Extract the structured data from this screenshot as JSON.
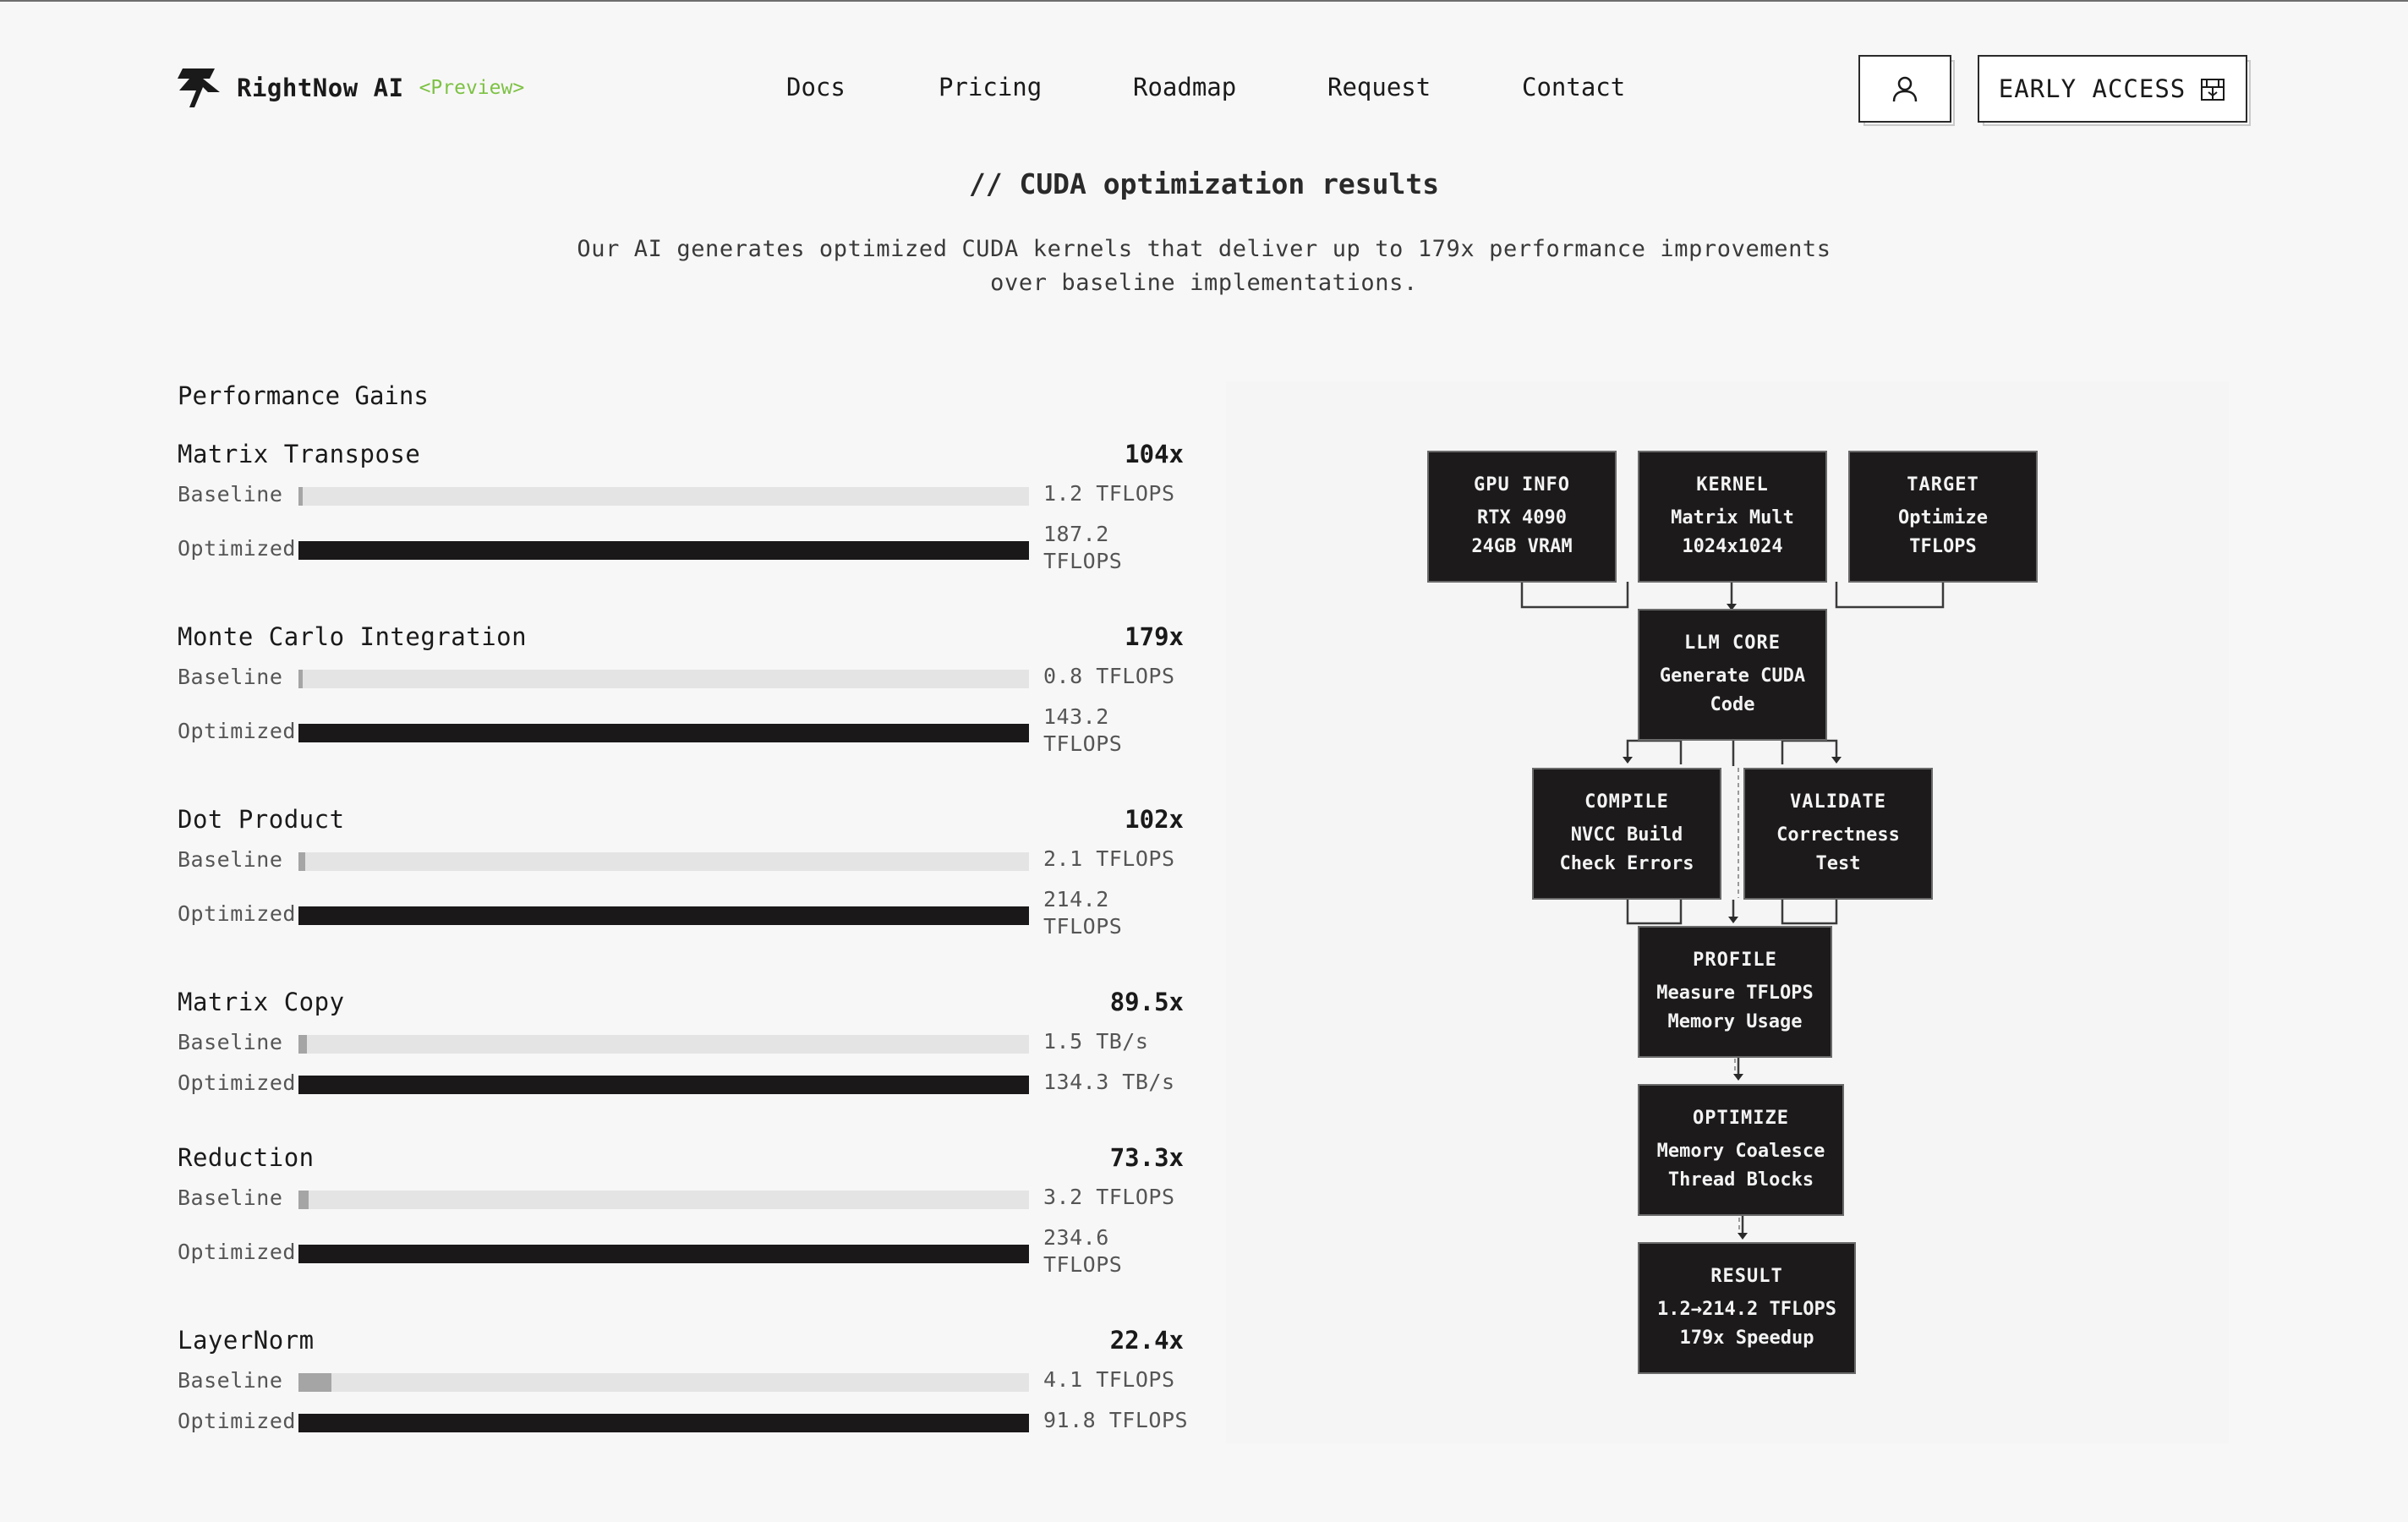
{
  "brand": {
    "name": "RightNow AI",
    "tag": "<Preview>",
    "accent": "#7cc243"
  },
  "nav": {
    "items": [
      "Docs",
      "Pricing",
      "Roadmap",
      "Request",
      "Contact"
    ]
  },
  "actions": {
    "user_icon": "user-icon",
    "early_access_label": "EARLY ACCESS",
    "early_access_icon": "open-box-icon"
  },
  "hero": {
    "title": "// CUDA optimization results",
    "description_line1": "Our AI generates optimized CUDA kernels that deliver up to 179x performance improvements",
    "description_line2": "over baseline implementations."
  },
  "performance": {
    "title": "Performance Gains",
    "baseline_label": "Baseline",
    "optimized_label": "Optimized",
    "metrics": [
      {
        "name": "Matrix Transpose",
        "speedup": "104x",
        "baseline_value": "1.2 TFLOPS",
        "optimized_value_line1": "187.2",
        "optimized_value_line2": "TFLOPS",
        "baseline_fraction": 0.006
      },
      {
        "name": "Monte Carlo Integration",
        "speedup": "179x",
        "baseline_value": "0.8 TFLOPS",
        "optimized_value_line1": "143.2",
        "optimized_value_line2": "TFLOPS",
        "baseline_fraction": 0.006
      },
      {
        "name": "Dot Product",
        "speedup": "102x",
        "baseline_value": "2.1 TFLOPS",
        "optimized_value_line1": "214.2",
        "optimized_value_line2": "TFLOPS",
        "baseline_fraction": 0.0098
      },
      {
        "name": "Matrix Copy",
        "speedup": "89.5x",
        "baseline_value": "1.5 TB/s",
        "optimized_value_line1": "134.3 TB/s",
        "optimized_value_line2": "",
        "baseline_fraction": 0.0112
      },
      {
        "name": "Reduction",
        "speedup": "73.3x",
        "baseline_value": "3.2 TFLOPS",
        "optimized_value_line1": "234.6",
        "optimized_value_line2": "TFLOPS",
        "baseline_fraction": 0.0136
      },
      {
        "name": "LayerNorm",
        "speedup": "22.4x",
        "baseline_value": "4.1 TFLOPS",
        "optimized_value_line1": "91.8 TFLOPS",
        "optimized_value_line2": "",
        "baseline_fraction": 0.0447
      }
    ]
  },
  "pipeline": {
    "gpu_info": {
      "title": "GPU INFO",
      "line1": "RTX 4090",
      "line2": "24GB VRAM"
    },
    "kernel": {
      "title": "KERNEL",
      "line1": "Matrix Mult",
      "line2": "1024x1024"
    },
    "target": {
      "title": "TARGET",
      "line1": "Optimize",
      "line2": "TFLOPS"
    },
    "llm_core": {
      "title": "LLM CORE",
      "line1": "Generate CUDA",
      "line2": "Code"
    },
    "compile": {
      "title": "COMPILE",
      "line1": "NVCC Build",
      "line2": "Check Errors"
    },
    "validate": {
      "title": "VALIDATE",
      "line1": "Correctness",
      "line2": "Test"
    },
    "profile": {
      "title": "PROFILE",
      "line1": "Measure TFLOPS",
      "line2": "Memory Usage"
    },
    "optimize": {
      "title": "OPTIMIZE",
      "line1": "Memory Coalesce",
      "line2": "Thread Blocks"
    },
    "result": {
      "title": "RESULT",
      "line1": "1.2→214.2 TFLOPS",
      "line2": "179x Speedup"
    }
  }
}
